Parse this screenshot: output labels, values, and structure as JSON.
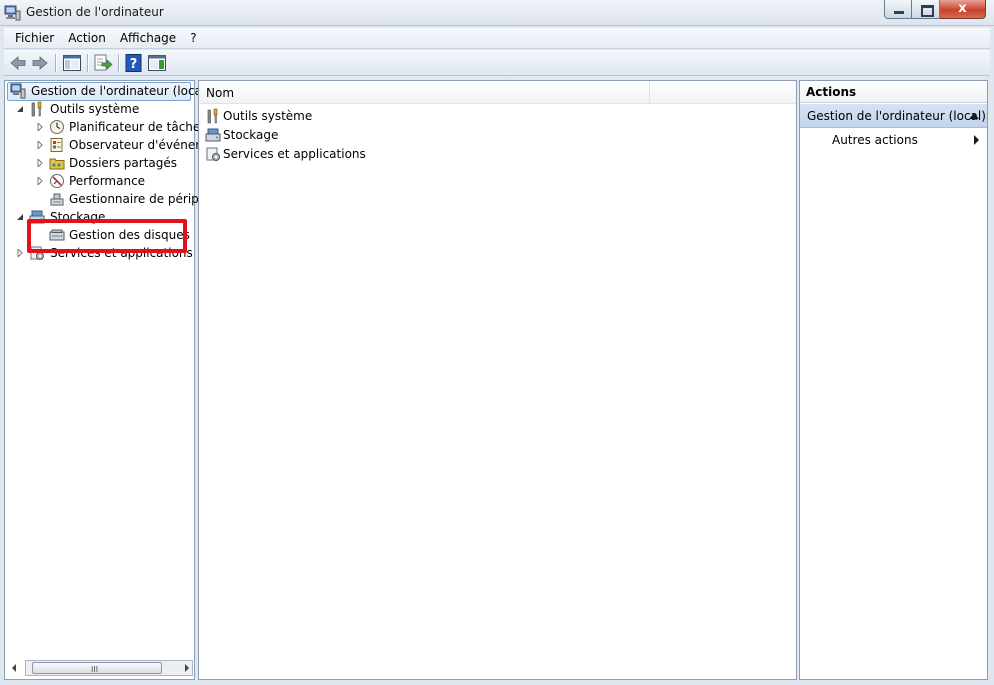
{
  "window": {
    "title": "Gestion de l'ordinateur",
    "close_glyph": "x"
  },
  "menubar": {
    "items": [
      "Fichier",
      "Action",
      "Affichage",
      "?"
    ]
  },
  "toolbar": {
    "icons": [
      "back-arrow-icon",
      "forward-arrow-icon",
      "show-hide-tree-icon",
      "export-list-icon",
      "help-icon",
      "show-hide-action-pane-icon"
    ]
  },
  "tree": {
    "root": "Gestion de l'ordinateur (local)",
    "outils": {
      "label": "Outils système",
      "children": [
        "Planificateur de tâches",
        "Observateur d'événeme",
        "Dossiers partagés",
        "Performance",
        "Gestionnaire de périphé"
      ]
    },
    "stockage": {
      "label": "Stockage",
      "children": [
        "Gestion des disques"
      ]
    },
    "services": "Services et applications",
    "scroll_grip": "III"
  },
  "list": {
    "column_name": "Nom",
    "rows": [
      "Outils système",
      "Stockage",
      "Services et applications"
    ]
  },
  "actions": {
    "title": "Actions",
    "section": "Gestion de l'ordinateur (local)",
    "item": "Autres actions"
  },
  "colors": {
    "highlight": "#e3111c",
    "selection": "#dbe8f7",
    "section_bg": "#c2d4ec"
  }
}
